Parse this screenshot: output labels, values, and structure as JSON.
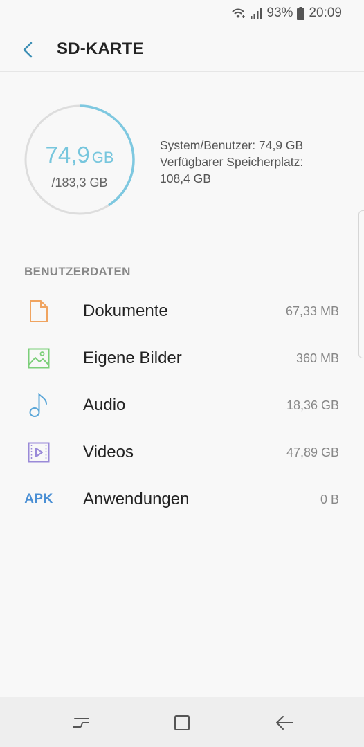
{
  "status_bar": {
    "battery": "93%",
    "time": "20:09",
    "icons": [
      "wifi-icon",
      "signal-icon",
      "battery-icon"
    ]
  },
  "header": {
    "title": "SD-KARTE",
    "back_icon": "back-arrow-icon"
  },
  "storage": {
    "used_value": "74,9",
    "used_unit": "GB",
    "total": "/183,3 GB",
    "used_fraction": 0.409,
    "ring_color": "#7ec8e0",
    "system_user": "System/Benutzer: 74,9 GB",
    "available_label": "Verfügbarer Speicherplatz:",
    "available_value": "108,4 GB"
  },
  "section": {
    "title": "BENUTZERDATEN"
  },
  "items": [
    {
      "label": "Dokumente",
      "size": "67,33 MB",
      "icon": "document-icon",
      "color": "#f0a460"
    },
    {
      "label": "Eigene Bilder",
      "size": "360 MB",
      "icon": "image-icon",
      "color": "#7ccf7a"
    },
    {
      "label": "Audio",
      "size": "18,36 GB",
      "icon": "music-note-icon",
      "color": "#5aa6d8"
    },
    {
      "label": "Videos",
      "size": "47,89 GB",
      "icon": "video-icon",
      "color": "#9a8ad8"
    },
    {
      "label": "Anwendungen",
      "size": "0 B",
      "icon": "apk-icon",
      "icon_text": "APK",
      "color": "#4a8fd4"
    }
  ],
  "nav_bar": {
    "icons": [
      "recent-apps-icon",
      "home-icon",
      "back-icon"
    ]
  }
}
